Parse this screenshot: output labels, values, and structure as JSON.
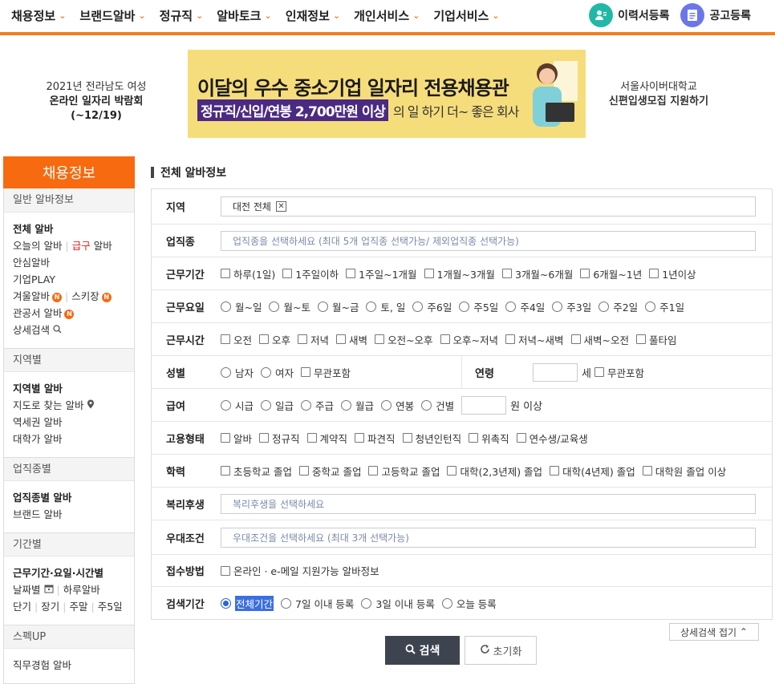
{
  "topnav": {
    "menu": [
      "채용정보",
      "브랜드알바",
      "정규직",
      "알바토크",
      "인재정보",
      "개인서비스",
      "기업서비스"
    ],
    "resume_label": "이력서등록",
    "post_label": "공고등록",
    "resume_color": "#22b8a8",
    "post_color": "#6b77e8",
    "accent": "#f47c20"
  },
  "banner": {
    "left_line1": "2021년 전라남도 여성",
    "left_line2": "온라인 일자리 박람회 (~12/19)",
    "ad_title": "이달의 우수 중소기업 일자리 전용채용관",
    "ad_highlight": "정규직/신입/연봉 2,700만원 이상",
    "ad_sub": "의 일 하기 더~ 좋은 회사",
    "right_line1": "서울사이버대학교",
    "right_line2": "신편입생모집 지원하기"
  },
  "sidebar": {
    "head": "채용정보",
    "g1_title": "일반 알바정보",
    "g1_all": "전체 알바",
    "g1_today": "오늘의 알바",
    "g1_urgent": "급구",
    "g1_urgent_suffix": " 알바",
    "g1_safe": "안심알바",
    "g1_play": "기업PLAY",
    "g1_winter": "겨울알바",
    "g1_ski": "스키장",
    "g1_public": "관공서 알바",
    "g1_detail": "상세검색",
    "g2_title": "지역별",
    "g2_region": "지역별 알바",
    "g2_map": "지도로 찾는 알바",
    "g2_station": "역세권 알바",
    "g2_univ": "대학가 알바",
    "g3_title": "업직종별",
    "g3_job": "업직종별 알바",
    "g3_brand": "브랜드 알바",
    "g4_title": "기간별",
    "g4_period": "근무기간·요일·시간별",
    "g4_daily": "날짜별",
    "g4_oneday": "하루알바",
    "g4_long": "단기",
    "g4_jang": "장기",
    "g4_weekend": "주말",
    "g4_five": "주5일",
    "g5_title": "스펙UP",
    "g5_exp": "직무경험 알바",
    "new_badge": "N"
  },
  "main": {
    "title": "전체 알바정보",
    "region_label": "지역",
    "region_value": "대전 전체",
    "job_label": "업직종",
    "job_placeholder": "업직종을 선택하세요 (최대 5개 업직종 선택가능/ 제외업직종 선택가능)",
    "period_label": "근무기간",
    "period_opts": [
      "하루(1일)",
      "1주일이하",
      "1주일~1개월",
      "1개월~3개월",
      "3개월~6개월",
      "6개월~1년",
      "1년이상"
    ],
    "days_label": "근무요일",
    "days_opts": [
      "월~일",
      "월~토",
      "월~금",
      "토, 일",
      "주6일",
      "주5일",
      "주4일",
      "주3일",
      "주2일",
      "주1일"
    ],
    "time_label": "근무시간",
    "time_opts": [
      "오전",
      "오후",
      "저녁",
      "새벽",
      "오전~오후",
      "오후~저녁",
      "저녁~새벽",
      "새벽~오전",
      "풀타임"
    ],
    "gender_label": "성별",
    "gender_opts": [
      "남자",
      "여자"
    ],
    "gender_any": "무관포함",
    "age_label": "연령",
    "age_unit": "세",
    "age_any": "무관포함",
    "pay_label": "급여",
    "pay_opts": [
      "시급",
      "일급",
      "주급",
      "월급",
      "연봉",
      "건별"
    ],
    "pay_unit": "원 이상",
    "emp_label": "고용형태",
    "emp_opts": [
      "알바",
      "정규직",
      "계약직",
      "파견직",
      "청년인턴직",
      "위촉직",
      "연수생/교육생"
    ],
    "edu_label": "학력",
    "edu_opts": [
      "초등학교 졸업",
      "중학교 졸업",
      "고등학교 졸업",
      "대학(2,3년제) 졸업",
      "대학(4년제) 졸업",
      "대학원 졸업 이상"
    ],
    "welfare_label": "복리후생",
    "welfare_placeholder": "복리후생을 선택하세요",
    "pref_label": "우대조건",
    "pref_placeholder": "우대조건을 선택하세요 (최대 3개 선택가능)",
    "apply_label": "접수방법",
    "apply_opt": "온라인 · e-메일 지원가능 알바정보",
    "search_period_label": "검색기간",
    "search_period_opts": [
      "전체기간",
      "7일 이내 등록",
      "3일 이내 등록",
      "오늘 등록"
    ],
    "fold_label": "상세검색 접기",
    "search_btn": "검색",
    "reset_btn": "초기화"
  }
}
